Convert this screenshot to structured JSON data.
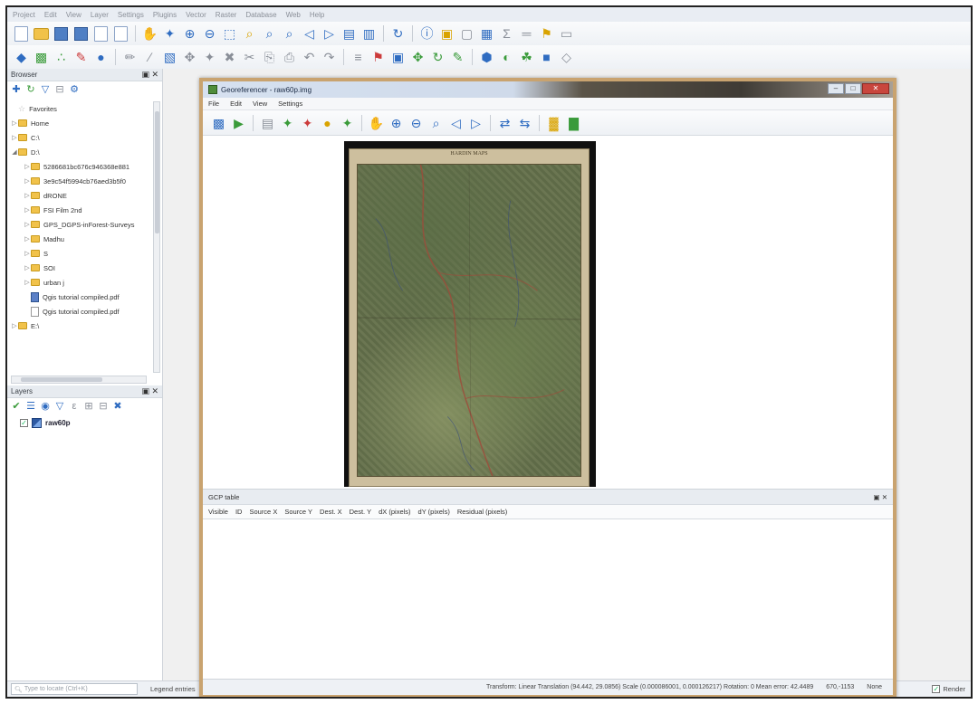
{
  "main_menu": [
    "Project",
    "Edit",
    "View",
    "Layer",
    "Settings",
    "Plugins",
    "Vector",
    "Raster",
    "Database",
    "Web",
    "Help"
  ],
  "toolbar1_icons": [
    "new-project",
    "open-project",
    "save-project",
    "save-as",
    "print-composer",
    "composer-manager",
    "pan",
    "pan-to-selection",
    "zoom-in",
    "zoom-out",
    "zoom-full",
    "zoom-selection",
    "zoom-layer",
    "zoom-native",
    "zoom-last",
    "zoom-next",
    "new-bookmark",
    "show-bookmarks",
    "refresh",
    "identify",
    "select",
    "deselect",
    "open-table",
    "statistics",
    "measure",
    "map-tips",
    "text-annotation"
  ],
  "toolbar2_icons": [
    "add-vector",
    "add-raster",
    "add-csv",
    "digitize",
    "toggle-edit",
    "edit-pencil",
    "save-edits",
    "add-feature",
    "move-feature",
    "node-tool",
    "delete-selected",
    "cut",
    "copy",
    "paste",
    "undo",
    "redo",
    "label",
    "label-pin",
    "label-highlight",
    "label-move",
    "label-rotate",
    "label-change",
    "python",
    "plugin-globe",
    "plugin-leaf",
    "grass",
    "grass-tools"
  ],
  "browser": {
    "title": "Browser",
    "items": [
      {
        "label": "Favorites",
        "type": "fav",
        "indent": 1
      },
      {
        "label": "Home",
        "type": "folder",
        "indent": 1
      },
      {
        "label": "C:\\",
        "type": "folder",
        "indent": 1
      },
      {
        "label": "D:\\",
        "type": "folder",
        "indent": 1,
        "expanded": true
      },
      {
        "label": "5286681bc676c946368e881",
        "type": "folder",
        "indent": 2
      },
      {
        "label": "3e9c54f5994cb76aed3b5f0",
        "type": "folder",
        "indent": 2
      },
      {
        "label": "dRONE",
        "type": "folder",
        "indent": 2
      },
      {
        "label": "FSI Film 2nd",
        "type": "folder",
        "indent": 2
      },
      {
        "label": "GPS_DGPS-inForest-Surveys",
        "type": "folder",
        "indent": 2
      },
      {
        "label": "Madhu",
        "type": "folder",
        "indent": 2
      },
      {
        "label": "S",
        "type": "folder",
        "indent": 2
      },
      {
        "label": "SOI",
        "type": "folder",
        "indent": 2
      },
      {
        "label": "urban j",
        "type": "folder",
        "indent": 2
      },
      {
        "label": "Qgis tutorial compiled.pdf",
        "type": "pdf-blue",
        "indent": 2
      },
      {
        "label": "Qgis tutorial compiled.pdf",
        "type": "pdf",
        "indent": 2
      },
      {
        "label": "E:\\",
        "type": "folder",
        "indent": 1
      }
    ]
  },
  "layers": {
    "title": "Layers",
    "items": [
      {
        "label": "raw60p",
        "checked": true
      }
    ]
  },
  "main_status": {
    "search_placeholder": "Type to locate (Ctrl+K)",
    "legend": "Legend entries",
    "render": "Render"
  },
  "georef": {
    "title": "Georeferencer - raw60p.img",
    "menu": [
      "File",
      "Edit",
      "View",
      "Settings"
    ],
    "toolbar_icons": [
      "open-raster",
      "start-georef",
      "gcp-points",
      "add-point",
      "delete-point",
      "move-gcp",
      "load-gcp",
      "pan",
      "zoom-in",
      "zoom-out",
      "zoom-layer",
      "zoom-last",
      "zoom-next",
      "link-georef",
      "link-qgis",
      "transform-settings",
      "full-histogram"
    ],
    "map_header": "HARDIN MAPS",
    "gcp_table": {
      "title": "GCP table",
      "columns": [
        "Visible",
        "ID",
        "Source X",
        "Source Y",
        "Dest. X",
        "Dest. Y",
        "dX (pixels)",
        "dY (pixels)",
        "Residual (pixels)"
      ]
    },
    "status": {
      "transform": "Transform: Linear Translation (94.442, 29.0856) Scale (0.000086001, 0.000126217) Rotation: 0 Mean error: 42.4489",
      "coords": "670,-1153",
      "crs": "None"
    }
  }
}
